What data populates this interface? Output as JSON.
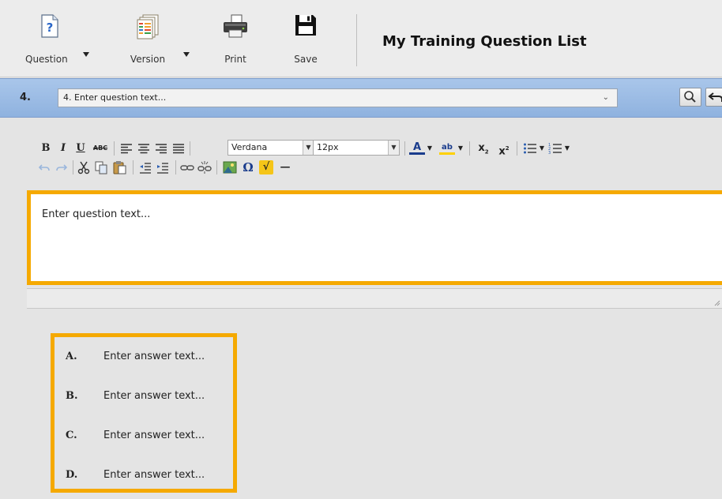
{
  "toolbar": {
    "question_label": "Question",
    "version_label": "Version",
    "print_label": "Print",
    "save_label": "Save",
    "question_icon_glyph": "?"
  },
  "app_title": "My Training Question List",
  "question_bar": {
    "number": "4.",
    "selected_question": "4. Enter question text..."
  },
  "editor": {
    "toolbar": {
      "bold": "B",
      "italic": "I",
      "underline": "U",
      "strikethrough": "ABC",
      "font_family": "Verdana",
      "font_size": "12px",
      "text_color": "A",
      "highlight": "ab",
      "subscript": "x",
      "superscript": "x",
      "omega": "Ω",
      "equation": "√"
    },
    "question_placeholder": "Enter question text..."
  },
  "answers": [
    {
      "letter": "A.",
      "text": "Enter answer text..."
    },
    {
      "letter": "B.",
      "text": "Enter answer text..."
    },
    {
      "letter": "C.",
      "text": "Enter answer text..."
    },
    {
      "letter": "D.",
      "text": "Enter answer text..."
    }
  ],
  "colors": {
    "highlight_border": "#f5a900",
    "question_bar": "#9bbbe4",
    "background": "#e4e4e4"
  }
}
